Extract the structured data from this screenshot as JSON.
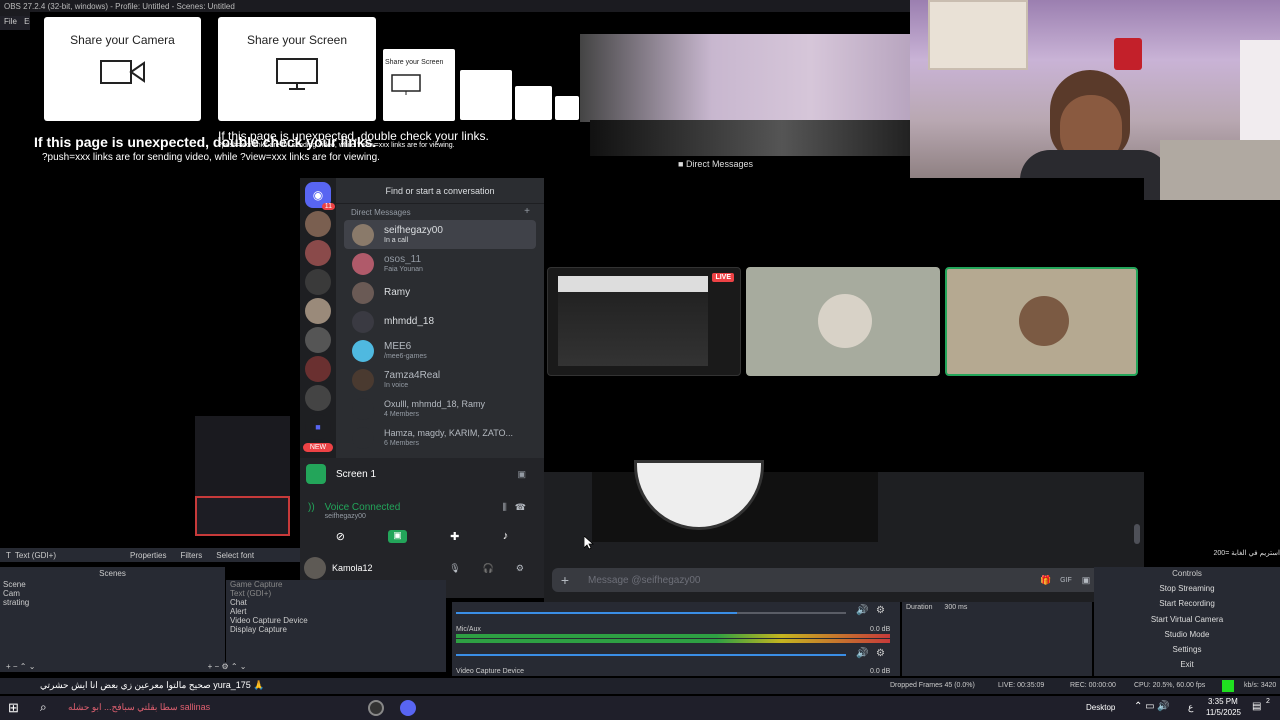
{
  "obs": {
    "title": "OBS 27.2.4 (32-bit, windows) - Profile: Untitled - Scenes: Untitled",
    "menu_file": "File",
    "menu_edit": "Ed",
    "source_name": "Text (GDI+)",
    "properties": "Properties",
    "filters": "Filters",
    "select_font": "Select font",
    "scenes_header": "Scenes",
    "scenes": [
      "Scene",
      "Cam",
      "strating"
    ],
    "sources": [
      "Game Capture",
      "Text (GDI+)",
      "Chat",
      "Alert",
      "Video Capture Device",
      "Display Capture"
    ],
    "mixer": {
      "transition_label": "Duration",
      "transition_value": "300 ms",
      "track1": "Mic/Aux",
      "track1_db": "0.0 dB",
      "track2": "Video Capture Device",
      "track2_db": "0.0 dB",
      "scale": [
        "-60",
        "-55",
        "-50",
        "-45",
        "-40",
        "-35",
        "-30",
        "-25",
        "-20",
        "-15",
        "-10",
        "-5",
        "0"
      ]
    },
    "controls_header": "Controls",
    "controls": [
      "Stop Streaming",
      "Start Recording",
      "Start Virtual Camera",
      "Studio Mode",
      "Settings",
      "Exit"
    ],
    "status": {
      "dropped": "Dropped Frames 45 (0.0%)",
      "live": "LIVE: 00:35:09",
      "rec": "REC: 00:00:00",
      "cpu": "CPU: 20.5%, 60.00 fps",
      "kbps": "kb/s: 3420"
    },
    "chat_overlay_line": "200= استريم في الغابة",
    "chat_ticker": "صحيح مالتوا معرعين زي بعض انا ايش حشرتي yura_175 🙏"
  },
  "share_page": {
    "camera_label": "Share your Camera",
    "screen_label": "Share your Screen",
    "warning_title": "If this page is unexpected, double check your links.",
    "warning_body": "?push=xxx links are for sending video, while ?view=xxx links are for viewing.",
    "echo_title": "If this page is unexpected, double check your links.",
    "echo_body": "?push=xxx links are for sending video, while ?view=xxx links are for viewing.",
    "echo_screen": "Share your Screen",
    "echo_dm": "Direct Messages"
  },
  "discord": {
    "search_placeholder": "Find or start a conversation",
    "dm_header": "Direct Messages",
    "badge_count": "11",
    "new_badge": "NEW",
    "dms": [
      {
        "name": "seifhegazy00",
        "status": "In a call"
      },
      {
        "name": "osos_11",
        "status": "Faia Younan"
      },
      {
        "name": "Ramy",
        "status": ""
      },
      {
        "name": "mhmdd_18",
        "status": ""
      },
      {
        "name": "MEE6",
        "status": "/mee6-games"
      },
      {
        "name": "7amza4Real",
        "status": "In voice"
      },
      {
        "name": "Oxulll, mhmdd_18, Ramy",
        "status": "4 Members"
      },
      {
        "name": "Hamza, magdy, KARIM, ZATO...",
        "status": "6 Members"
      }
    ],
    "screen_panel_title": "Screen 1",
    "voice_connected": "Voice Connected",
    "voice_sub": "seifhegazy00",
    "user_name": "Kamola12",
    "message_placeholder": "Message @seifhegazy00",
    "live_badge": "LIVE",
    "echo_dm_header": "Direct Messages"
  },
  "taskbar": {
    "desktop": "Desktop",
    "time": "3:35 PM",
    "date": "11/5/2025",
    "lang": "ع",
    "notif": "2",
    "ticker": "سطا بقلتي سبافح... ابو حشله sallinas"
  },
  "colors": {
    "discord_blurple": "#5865f2",
    "live_red": "#ed4245",
    "voice_green": "#23a55a",
    "obs_panel": "#272a33"
  }
}
